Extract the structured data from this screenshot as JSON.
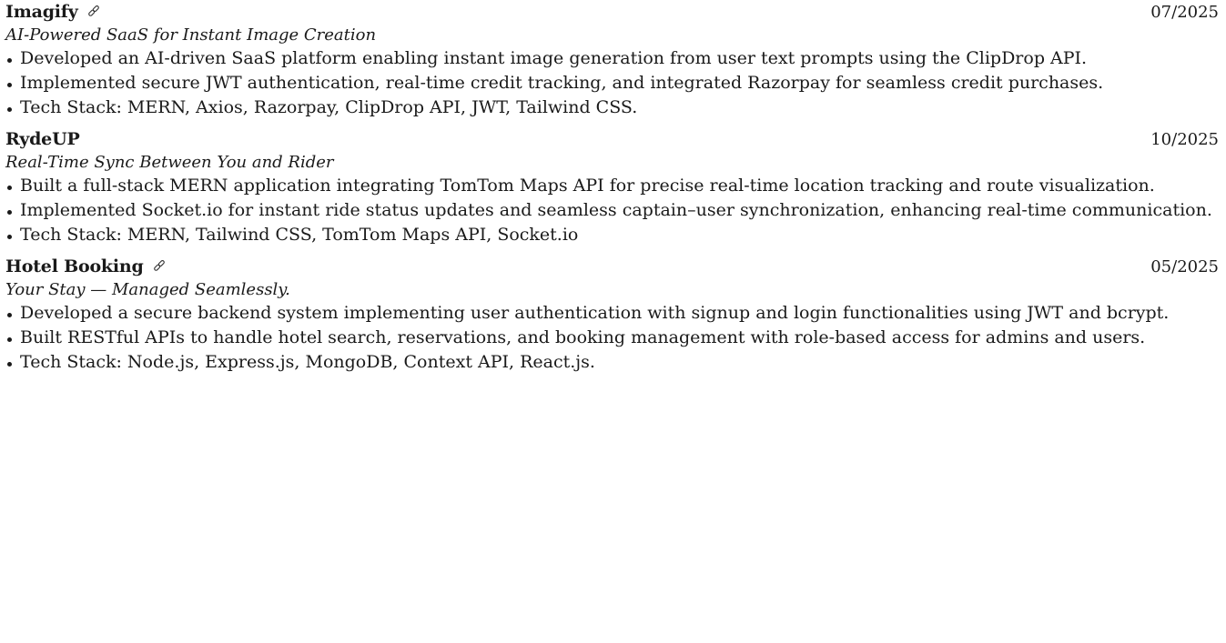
{
  "projects": [
    {
      "title": "Imagify",
      "has_link": true,
      "date": "07/2025",
      "subtitle": "AI-Powered SaaS for Instant Image Creation",
      "bullets": [
        "Developed an AI-driven SaaS platform enabling instant image generation from user text prompts using the ClipDrop API.",
        "Implemented secure JWT authentication, real-time credit tracking, and integrated Razorpay for seamless credit purchases.",
        "Tech Stack: MERN, Axios, Razorpay, ClipDrop API, JWT, Tailwind CSS."
      ]
    },
    {
      "title": "RydeUP",
      "has_link": false,
      "date": "10/2025",
      "subtitle": "Real-Time Sync Between You and Rider",
      "bullets": [
        "Built a full-stack MERN application integrating TomTom Maps API for precise real-time location tracking and route visualization.",
        "Implemented Socket.io for instant ride status updates and seamless captain–user synchronization, enhancing real-time communication.",
        "Tech Stack: MERN, Tailwind CSS, TomTom Maps API, Socket.io"
      ]
    },
    {
      "title": "Hotel Booking",
      "has_link": true,
      "date": "05/2025",
      "subtitle": "Your Stay — Managed Seamlessly.",
      "bullets": [
        "Developed a secure backend system implementing user authentication with signup and login functionalities using JWT and bcrypt.",
        "Built RESTful APIs to handle hotel search, reservations, and booking management with role-based access for admins and users.",
        "Tech Stack: Node.js, Express.js, MongoDB, Context API, React.js."
      ]
    }
  ],
  "icons": {
    "link": "link-icon"
  }
}
